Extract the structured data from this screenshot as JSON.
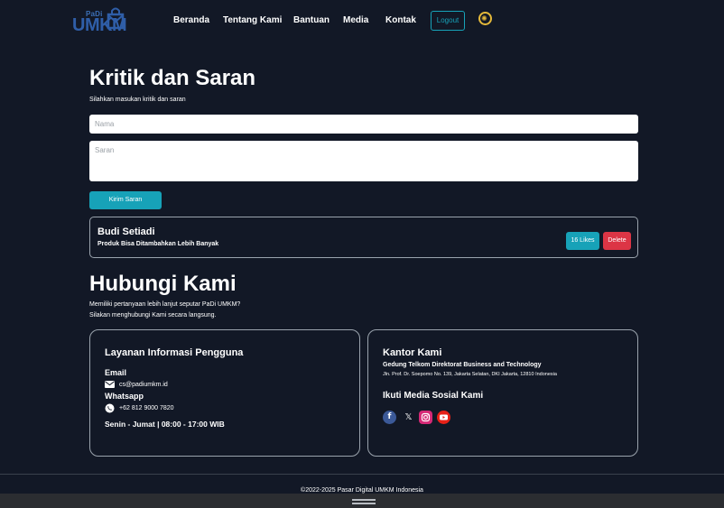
{
  "brand": {
    "logo_top": "PaDi",
    "logo_main": "UMKM"
  },
  "nav": {
    "links": [
      "Beranda",
      "Tentang Kami",
      "Bantuan",
      "Media",
      "Kontak"
    ],
    "logout": "Logout"
  },
  "feedback": {
    "title": "Kritik dan Saran",
    "subtitle": "Silahkan masukan kritik dan saran",
    "name_placeholder": "Nama",
    "message_placeholder": "Saran",
    "submit": "Kirim Saran",
    "entries": [
      {
        "name": "Budi Setiadi",
        "text": "Produk Bisa Ditambahkan Lebih Banyak",
        "likes": "16 Likes",
        "delete": "Delete"
      }
    ]
  },
  "contact": {
    "title": "Hubungi Kami",
    "desc_line1": "Memiliki pertanyaan lebih lanjut seputar PaDi UMKM?",
    "desc_line2": "Silakan menghubungi Kami secara langsung.",
    "info": {
      "title": "Layanan Informasi Pengguna",
      "email_label": "Email",
      "email": "cs@padiumkm.id",
      "whatsapp_label": "Whatsapp",
      "whatsapp": "+62 812 9000 7820",
      "hours": "Senin - Jumat | 08:00 - 17:00 WIB"
    },
    "office": {
      "title": "Kantor Kami",
      "building": "Gedung Telkom Direktorat Business and Technology",
      "address": "Jln. Prof. Dr. Soepomo No. 139, Jakarta Selatan, DKI Jakarta, 12810 Indonesia",
      "social_title": "Ikuti Media Sosial Kami",
      "social_icons": [
        "facebook-icon",
        "x-icon",
        "instagram-icon",
        "youtube-icon"
      ]
    }
  },
  "footer": {
    "copyright": "©2022-2025 Pasar Digital UMKM Indonesia"
  },
  "colors": {
    "background": "#121826",
    "accent": "#17a2b8",
    "danger": "#dc3545",
    "theme_toggle": "#e5b93a"
  }
}
